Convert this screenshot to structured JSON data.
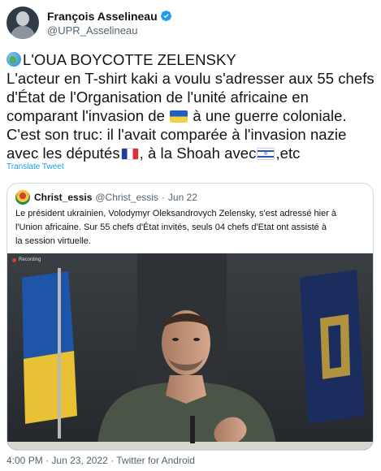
{
  "author": {
    "name": "François Asselineau",
    "handle": "@UPR_Asselineau",
    "verified": true
  },
  "tweet": {
    "line1": "L'OUA BOYCOTTE ZELENSKY",
    "line2": "L'acteur en T-shirt kaki a voulu s'adresser aux 55 chefs",
    "line3": "d'État de l'Organisation de l'unité africaine en",
    "line4a": "comparant l'invasion de ",
    "line4b": " à une guerre coloniale.",
    "line5": "C'est son truc: il l'avait comparée à l'invasion nazie",
    "line6a": "avec les députés",
    "line6b": ", à la Shoah avec",
    "line6c": ",etc",
    "icons": [
      "globe-icon",
      "ukraine-flag-icon",
      "france-flag-icon",
      "israel-flag-icon"
    ]
  },
  "translate_label": "Translate Tweet",
  "quoted": {
    "name": "Christ_essis",
    "handle": "@Christ_essis",
    "separator": "·",
    "date": "Jun 22",
    "text_line1": "Le président ukrainien, Volodymyr Oleksandrovych Zelensky, s'est adressé hier à",
    "text_line2": "l'Union africaine. Sur 55 chefs d'État invités, seuls 04 chefs d'Etat ont assisté à",
    "text_line3": "la session virtuelle.",
    "media_overlay": "Recording"
  },
  "footer": {
    "time": "4:00 PM",
    "separator": "·",
    "date": "Jun 23, 2022",
    "source": "Twitter for Android"
  },
  "colors": {
    "link": "#1d9bf0",
    "secondary_text": "#536471",
    "verified_badge": "#1d9bf0",
    "border": "#cfd9de"
  }
}
